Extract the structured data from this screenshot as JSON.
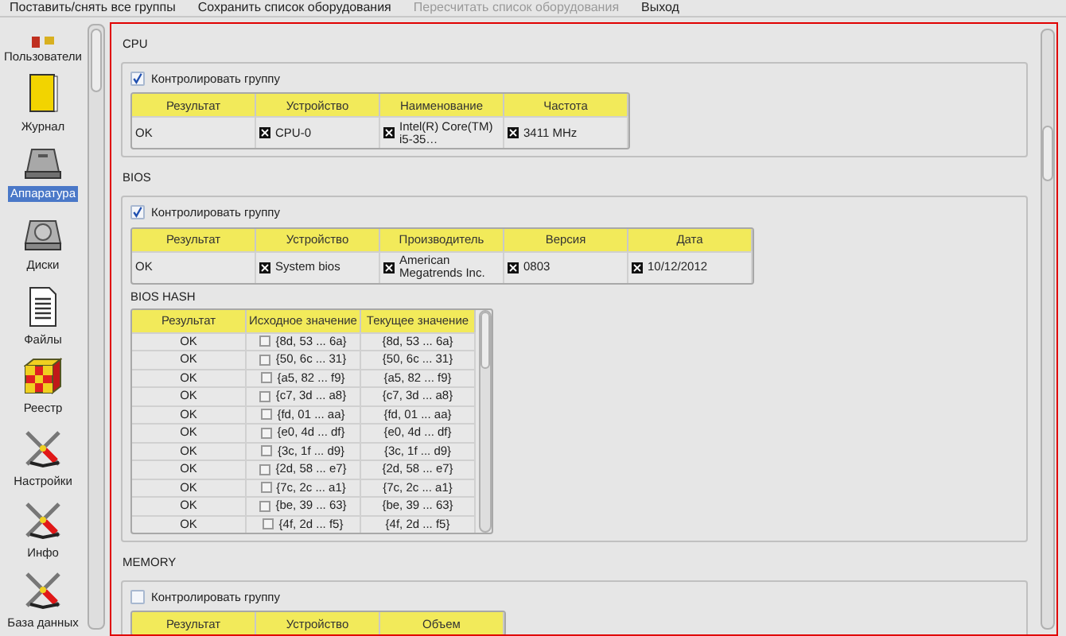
{
  "menu": [
    {
      "label": "Поставить/снять все группы",
      "disabled": false
    },
    {
      "label": "Сохранить список оборудования",
      "disabled": false
    },
    {
      "label": "Пересчитать список оборудования",
      "disabled": true
    },
    {
      "label": "Выход",
      "disabled": false
    }
  ],
  "sidebar": {
    "items": [
      {
        "label": "Пользователи",
        "kind": "users",
        "selected": false
      },
      {
        "label": "Журнал",
        "kind": "journal",
        "selected": false
      },
      {
        "label": "Аппаратура",
        "kind": "hardware",
        "selected": true
      },
      {
        "label": "Диски",
        "kind": "disk",
        "selected": false
      },
      {
        "label": "Файлы",
        "kind": "file",
        "selected": false
      },
      {
        "label": "Реестр",
        "kind": "registry",
        "selected": false
      },
      {
        "label": "Настройки",
        "kind": "tools",
        "selected": false
      },
      {
        "label": "Инфо",
        "kind": "tools",
        "selected": false
      },
      {
        "label": "База данных",
        "kind": "tools",
        "selected": false
      }
    ]
  },
  "sections": [
    {
      "title": "CPU",
      "monitor_checked": true,
      "monitor_label": "Контролировать группу",
      "tables": [
        {
          "columns": [
            "Результат",
            "Устройство",
            "Наименование",
            "Частота"
          ],
          "rows": [
            [
              {
                "text": "OK"
              },
              {
                "text": "CPU-0",
                "checked": true
              },
              {
                "text": "Intel(R) Core(TM) i5-35…",
                "checked": true
              },
              {
                "text": "3411 MHz",
                "checked": true
              }
            ]
          ]
        }
      ]
    },
    {
      "title": "BIOS",
      "monitor_checked": true,
      "monitor_label": "Контролировать группу",
      "tables": [
        {
          "columns": [
            "Результат",
            "Устройство",
            "Производитель",
            "Версия",
            "Дата"
          ],
          "rows": [
            [
              {
                "text": "OK"
              },
              {
                "text": "System bios",
                "checked": true
              },
              {
                "text": "American Megatrends Inc.",
                "checked": true
              },
              {
                "text": "0803",
                "checked": true
              },
              {
                "text": "10/12/2012",
                "checked": true
              }
            ]
          ]
        },
        {
          "title": "BIOS HASH",
          "scrollable": true,
          "columns": [
            "Результат",
            "Исходное значение",
            "Текущее значение"
          ],
          "rows": [
            [
              {
                "text": "OK"
              },
              {
                "text": "{8d, 53 ... 6a}",
                "checked": false
              },
              {
                "text": "{8d, 53 ... 6a}"
              }
            ],
            [
              {
                "text": "OK"
              },
              {
                "text": "{50, 6c ... 31}",
                "checked": false
              },
              {
                "text": "{50, 6c ... 31}"
              }
            ],
            [
              {
                "text": "OK"
              },
              {
                "text": "{a5, 82 ... f9}",
                "checked": false
              },
              {
                "text": "{a5, 82 ... f9}"
              }
            ],
            [
              {
                "text": "OK"
              },
              {
                "text": "{c7, 3d ... a8}",
                "checked": false
              },
              {
                "text": "{c7, 3d ... a8}"
              }
            ],
            [
              {
                "text": "OK"
              },
              {
                "text": "{fd, 01 ... aa}",
                "checked": false
              },
              {
                "text": "{fd, 01 ... aa}"
              }
            ],
            [
              {
                "text": "OK"
              },
              {
                "text": "{e0, 4d ... df}",
                "checked": false
              },
              {
                "text": "{e0, 4d ... df}"
              }
            ],
            [
              {
                "text": "OK"
              },
              {
                "text": "{3c, 1f ... d9}",
                "checked": false
              },
              {
                "text": "{3c, 1f ... d9}"
              }
            ],
            [
              {
                "text": "OK"
              },
              {
                "text": "{2d, 58 ... e7}",
                "checked": false
              },
              {
                "text": "{2d, 58 ... e7}"
              }
            ],
            [
              {
                "text": "OK"
              },
              {
                "text": "{7c, 2c ... a1}",
                "checked": false
              },
              {
                "text": "{7c, 2c ... a1}"
              }
            ],
            [
              {
                "text": "OK"
              },
              {
                "text": "{be, 39 ... 63}",
                "checked": false
              },
              {
                "text": "{be, 39 ... 63}"
              }
            ],
            [
              {
                "text": "OK"
              },
              {
                "text": "{4f, 2d ... f5}",
                "checked": false
              },
              {
                "text": "{4f, 2d ... f5}"
              }
            ]
          ]
        }
      ]
    },
    {
      "title": "MEMORY",
      "monitor_checked": false,
      "monitor_label": "Контролировать группу",
      "tables": [
        {
          "columns": [
            "Результат",
            "Устройство",
            "Объем"
          ]
        }
      ]
    }
  ]
}
